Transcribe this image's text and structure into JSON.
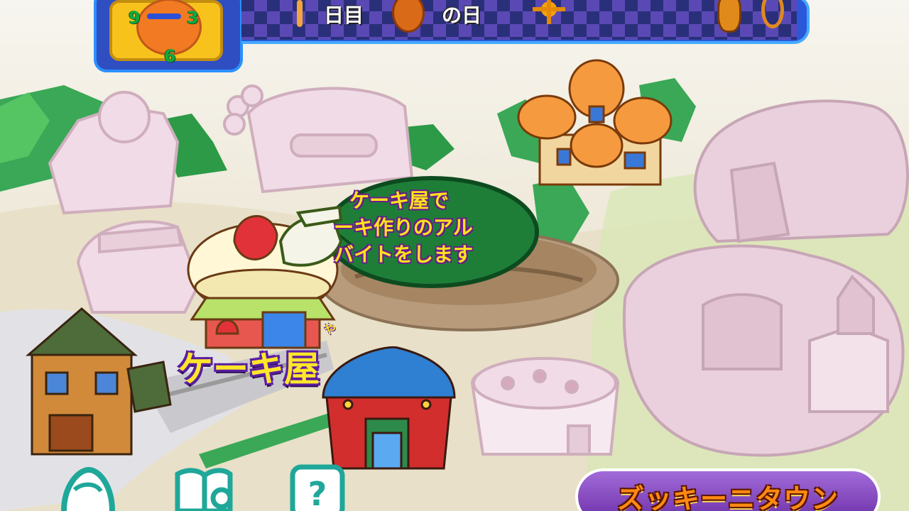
{
  "hud": {
    "clock": {
      "num_left": "9",
      "num_right": "3",
      "num_bottom": "6"
    },
    "date": {
      "day_suffix": "日目",
      "day_of_week_suffix": "の日"
    }
  },
  "map": {
    "selected_location": {
      "name": "ケーキ屋",
      "ruby": "や",
      "description_lines": [
        "ケーキ屋で",
        "ーキ作りのアル",
        "バイトをします"
      ]
    },
    "town_name": "ズッキーニタウン"
  },
  "menu": {
    "buttons": [
      {
        "icon": "character-icon"
      },
      {
        "icon": "book-search-icon"
      },
      {
        "icon": "help-icon"
      }
    ]
  },
  "colors": {
    "hud_blue": "#2a58d8",
    "hud_checker_dark": "#2a2f7a",
    "hud_checker_light": "#5a49b5",
    "clock_yellow": "#f8c21c",
    "label_yellow": "#ffe62a",
    "label_outline_purple": "#5a1ea0",
    "town_orange": "#ff8a12",
    "town_plate_purple": "#8a4cc8",
    "button_teal": "#1fa79a"
  }
}
